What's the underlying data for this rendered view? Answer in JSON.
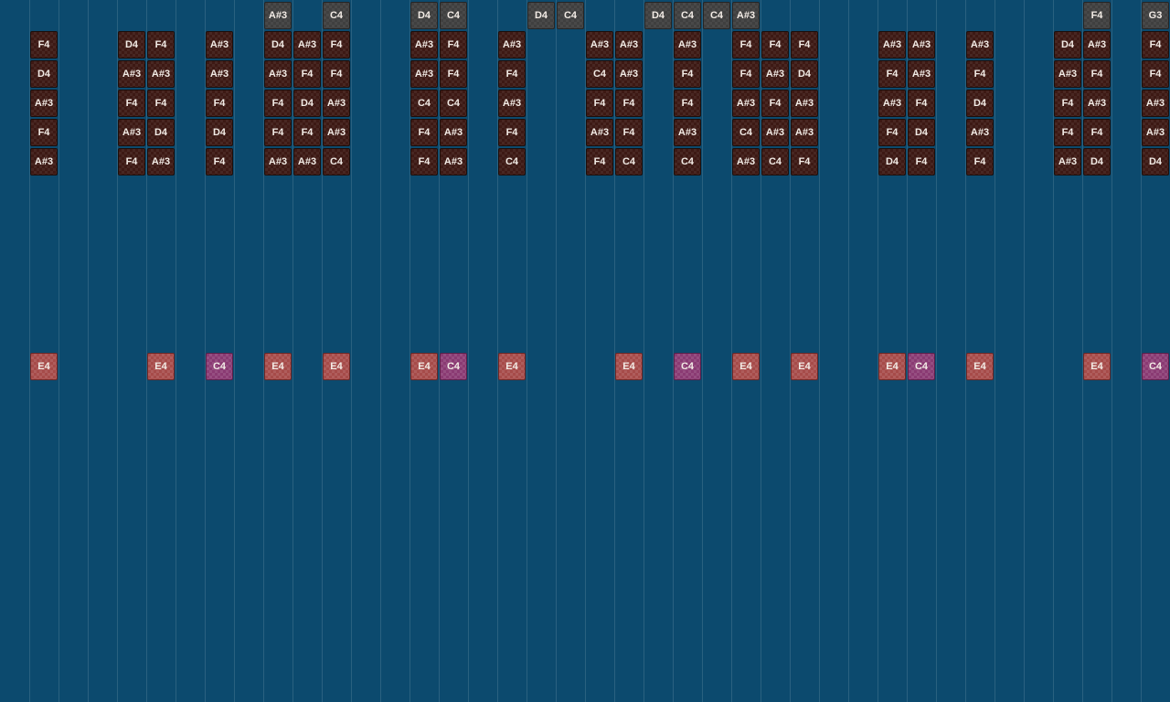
{
  "colors": {
    "background": "#0c4a6e",
    "grid_line": "#2a6180",
    "note_dark": "#3d1914",
    "note_grey": "#3f3f3f",
    "note_red": "#a64b49",
    "note_purple": "#8a3a73"
  },
  "grey_row": [
    {
      "col": 9,
      "label": "A#3"
    },
    {
      "col": 11,
      "label": "C4"
    },
    {
      "col": 14,
      "label": "D4"
    },
    {
      "col": 15,
      "label": "C4"
    },
    {
      "col": 18,
      "label": "D4"
    },
    {
      "col": 19,
      "label": "C4"
    },
    {
      "col": 22,
      "label": "D4"
    },
    {
      "col": 23,
      "label": "C4"
    },
    {
      "col": 24,
      "label": "C4"
    },
    {
      "col": 25,
      "label": "A#3"
    },
    {
      "col": 37,
      "label": "F4"
    },
    {
      "col": 39,
      "label": "G3"
    }
  ],
  "stack_columns": [
    {
      "col": 1,
      "notes": [
        "F4",
        "D4",
        "A#3",
        "F4",
        "A#3"
      ]
    },
    {
      "col": 4,
      "notes": [
        "D4",
        "A#3",
        "F4",
        "A#3",
        "F4"
      ]
    },
    {
      "col": 5,
      "notes": [
        "F4",
        "A#3",
        "F4",
        "D4",
        "A#3"
      ]
    },
    {
      "col": 7,
      "notes": [
        "A#3",
        "A#3",
        "F4",
        "D4",
        "F4"
      ]
    },
    {
      "col": 9,
      "notes": [
        "D4",
        "A#3",
        "F4",
        "F4",
        "A#3"
      ]
    },
    {
      "col": 10,
      "notes": [
        "A#3",
        "F4",
        "D4",
        "F4",
        "A#3"
      ]
    },
    {
      "col": 11,
      "notes": [
        "F4",
        "F4",
        "A#3",
        "A#3",
        "C4"
      ]
    },
    {
      "col": 14,
      "notes": [
        "A#3",
        "A#3",
        "C4",
        "F4",
        "F4"
      ]
    },
    {
      "col": 15,
      "notes": [
        "F4",
        "F4",
        "C4",
        "A#3",
        "A#3"
      ]
    },
    {
      "col": 17,
      "notes": [
        "A#3",
        "F4",
        "A#3",
        "F4",
        "C4"
      ]
    },
    {
      "col": 20,
      "notes": [
        "A#3",
        "C4",
        "F4",
        "A#3",
        "F4"
      ]
    },
    {
      "col": 21,
      "notes": [
        "A#3",
        "A#3",
        "F4",
        "F4",
        "C4"
      ]
    },
    {
      "col": 23,
      "notes": [
        "A#3",
        "F4",
        "F4",
        "A#3",
        "C4"
      ]
    },
    {
      "col": 25,
      "notes": [
        "F4",
        "F4",
        "A#3",
        "C4",
        "A#3"
      ]
    },
    {
      "col": 26,
      "notes": [
        "F4",
        "A#3",
        "F4",
        "A#3",
        "C4"
      ]
    },
    {
      "col": 27,
      "notes": [
        "F4",
        "D4",
        "A#3",
        "A#3",
        "F4"
      ]
    },
    {
      "col": 30,
      "notes": [
        "A#3",
        "F4",
        "A#3",
        "F4",
        "D4"
      ]
    },
    {
      "col": 31,
      "notes": [
        "A#3",
        "A#3",
        "F4",
        "D4",
        "F4"
      ]
    },
    {
      "col": 33,
      "notes": [
        "A#3",
        "F4",
        "D4",
        "A#3",
        "F4"
      ]
    },
    {
      "col": 36,
      "notes": [
        "D4",
        "A#3",
        "F4",
        "F4",
        "A#3"
      ]
    },
    {
      "col": 37,
      "notes": [
        "A#3",
        "F4",
        "A#3",
        "F4",
        "D4"
      ]
    },
    {
      "col": 39,
      "notes": [
        "F4",
        "F4",
        "A#3",
        "A#3",
        "D4"
      ]
    }
  ],
  "bottom_row": [
    {
      "col": 1,
      "label": "E4",
      "kind": "red"
    },
    {
      "col": 5,
      "label": "E4",
      "kind": "red"
    },
    {
      "col": 7,
      "label": "C4",
      "kind": "purple"
    },
    {
      "col": 9,
      "label": "E4",
      "kind": "red"
    },
    {
      "col": 11,
      "label": "E4",
      "kind": "red"
    },
    {
      "col": 14,
      "label": "E4",
      "kind": "red"
    },
    {
      "col": 15,
      "label": "C4",
      "kind": "purple"
    },
    {
      "col": 17,
      "label": "E4",
      "kind": "red"
    },
    {
      "col": 21,
      "label": "E4",
      "kind": "red"
    },
    {
      "col": 23,
      "label": "C4",
      "kind": "purple"
    },
    {
      "col": 25,
      "label": "E4",
      "kind": "red"
    },
    {
      "col": 27,
      "label": "E4",
      "kind": "red"
    },
    {
      "col": 30,
      "label": "E4",
      "kind": "red"
    },
    {
      "col": 31,
      "label": "C4",
      "kind": "purple"
    },
    {
      "col": 33,
      "label": "E4",
      "kind": "red"
    },
    {
      "col": 37,
      "label": "E4",
      "kind": "red"
    },
    {
      "col": 39,
      "label": "C4",
      "kind": "purple"
    }
  ]
}
